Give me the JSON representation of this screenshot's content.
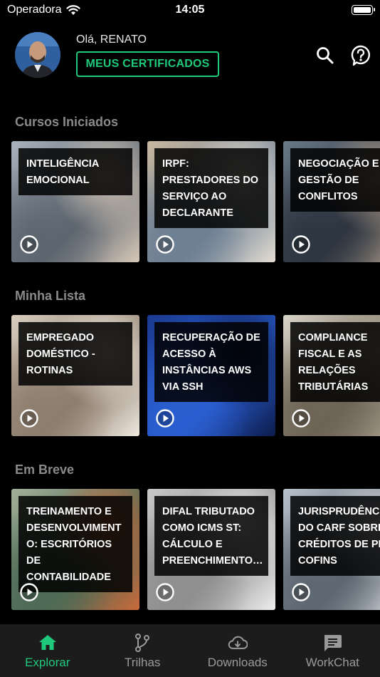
{
  "status_bar": {
    "carrier": "Operadora",
    "time": "14:05",
    "battery_level": 1.0
  },
  "header": {
    "greeting": "Olá, RENATO",
    "certificates_button": "MEUS CERTIFICADOS",
    "search_icon": "search-icon",
    "help_icon": "help-icon"
  },
  "accent_color": "#1fc97c",
  "sections": [
    {
      "title": "Cursos Iniciados",
      "cards": [
        {
          "lines": [
            "INTELIGÊNCIA",
            "EMOCIONAL"
          ],
          "palette": [
            "#a9b3bd",
            "#5d6670",
            "#d7c8b8"
          ]
        },
        {
          "lines": [
            "IRPF:",
            "PRESTADORES DO",
            "SERVIÇO AO",
            "DECLARANTE"
          ],
          "palette": [
            "#c9b89f",
            "#6d7f93",
            "#e4ddd2"
          ]
        },
        {
          "lines": [
            "NEGOCIAÇÃO E",
            "GESTÃO DE",
            "CONFLITOS"
          ],
          "palette": [
            "#6b7a88",
            "#2d3540",
            "#b9a48f"
          ]
        }
      ]
    },
    {
      "title": "Minha Lista",
      "cards": [
        {
          "lines": [
            "EMPREGADO",
            "DOMÉSTICO -",
            "ROTINAS"
          ],
          "palette": [
            "#d8cdbf",
            "#8d7d6d",
            "#efe8df"
          ]
        },
        {
          "lines": [
            "RECUPERAÇÃO DE",
            "ACESSO À",
            "INSTÂNCIAS AWS",
            "VIA SSH"
          ],
          "palette": [
            "#1a3a8f",
            "#2a5ed0",
            "#0c1b4a"
          ]
        },
        {
          "lines": [
            "COMPLIANCE",
            "FISCAL E AS",
            "RELAÇÕES",
            "TRIBUTÁRIAS"
          ],
          "palette": [
            "#d9d4c8",
            "#6e6456",
            "#b5ab99"
          ]
        }
      ]
    },
    {
      "title": "Em Breve",
      "cards": [
        {
          "lines": [
            "TREINAMENTO E",
            "DESENVOLVIMENT",
            "O: ESCRITÓRIOS DE",
            "CONTABILIDADE"
          ],
          "palette": [
            "#a3b09a",
            "#4d6a55",
            "#c96a3b"
          ]
        },
        {
          "lines": [
            "DIFAL TRIBUTADO",
            "COMO ICMS ST:",
            "CÁLCULO E",
            "PREENCHIMENTO…"
          ],
          "palette": [
            "#c8c8c8",
            "#8f8f8f",
            "#eeeeee"
          ]
        },
        {
          "lines": [
            "JURISPRUDÊNCIA",
            "DO CARF SOBRE",
            "CRÉDITOS DE PIS",
            "COFINS"
          ],
          "palette": [
            "#b9c2cc",
            "#5d6771",
            "#e1e4e8"
          ]
        }
      ]
    }
  ],
  "tabs": [
    {
      "label": "Explorar",
      "icon": "home-icon",
      "active": true
    },
    {
      "label": "Trilhas",
      "icon": "branch-icon",
      "active": false
    },
    {
      "label": "Downloads",
      "icon": "cloud-download-icon",
      "active": false
    },
    {
      "label": "WorkChat",
      "icon": "chat-icon",
      "active": false
    }
  ]
}
